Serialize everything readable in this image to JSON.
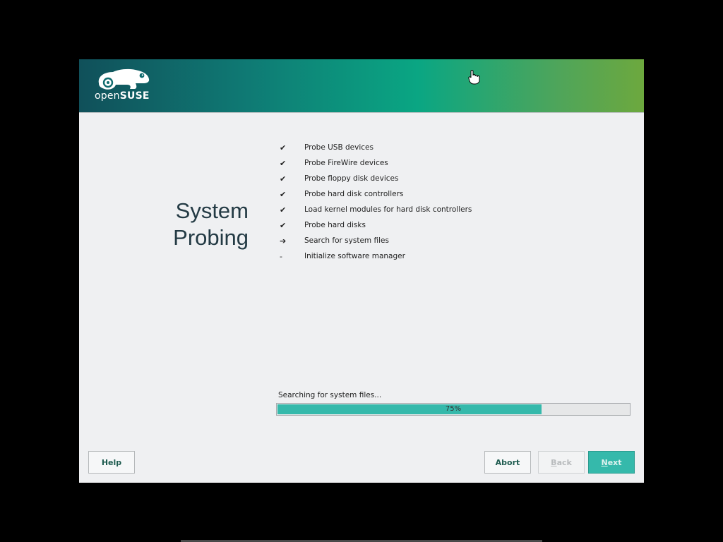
{
  "window": {
    "logo_text_prefix": "open",
    "logo_text_brand": "SUSE",
    "title_line1": "System",
    "title_line2": "Probing"
  },
  "steps": [
    {
      "status": "done",
      "mark": "✔",
      "label": "Probe USB devices"
    },
    {
      "status": "done",
      "mark": "✔",
      "label": "Probe FireWire devices"
    },
    {
      "status": "done",
      "mark": "✔",
      "label": "Probe floppy disk devices"
    },
    {
      "status": "done",
      "mark": "✔",
      "label": "Probe hard disk controllers"
    },
    {
      "status": "done",
      "mark": "✔",
      "label": "Load kernel modules for hard disk controllers"
    },
    {
      "status": "done",
      "mark": "✔",
      "label": "Probe hard disks"
    },
    {
      "status": "current",
      "mark": "➔",
      "label": "Search for system files"
    },
    {
      "status": "pending",
      "mark": "-",
      "label": "Initialize software manager"
    }
  ],
  "progress": {
    "label": "Searching for system files...",
    "value": 75,
    "text": "75%"
  },
  "buttons": {
    "help": {
      "label": "Help",
      "mnemonic": ""
    },
    "abort": {
      "label": "Abort",
      "mnemonic": ""
    },
    "back": {
      "label": "Back",
      "mnemonic": "B"
    },
    "next": {
      "label": "Next",
      "mnemonic": "N"
    }
  },
  "colors": {
    "accent": "#35b9ab",
    "banner_start": "#10505a",
    "banner_end": "#6da83e"
  }
}
